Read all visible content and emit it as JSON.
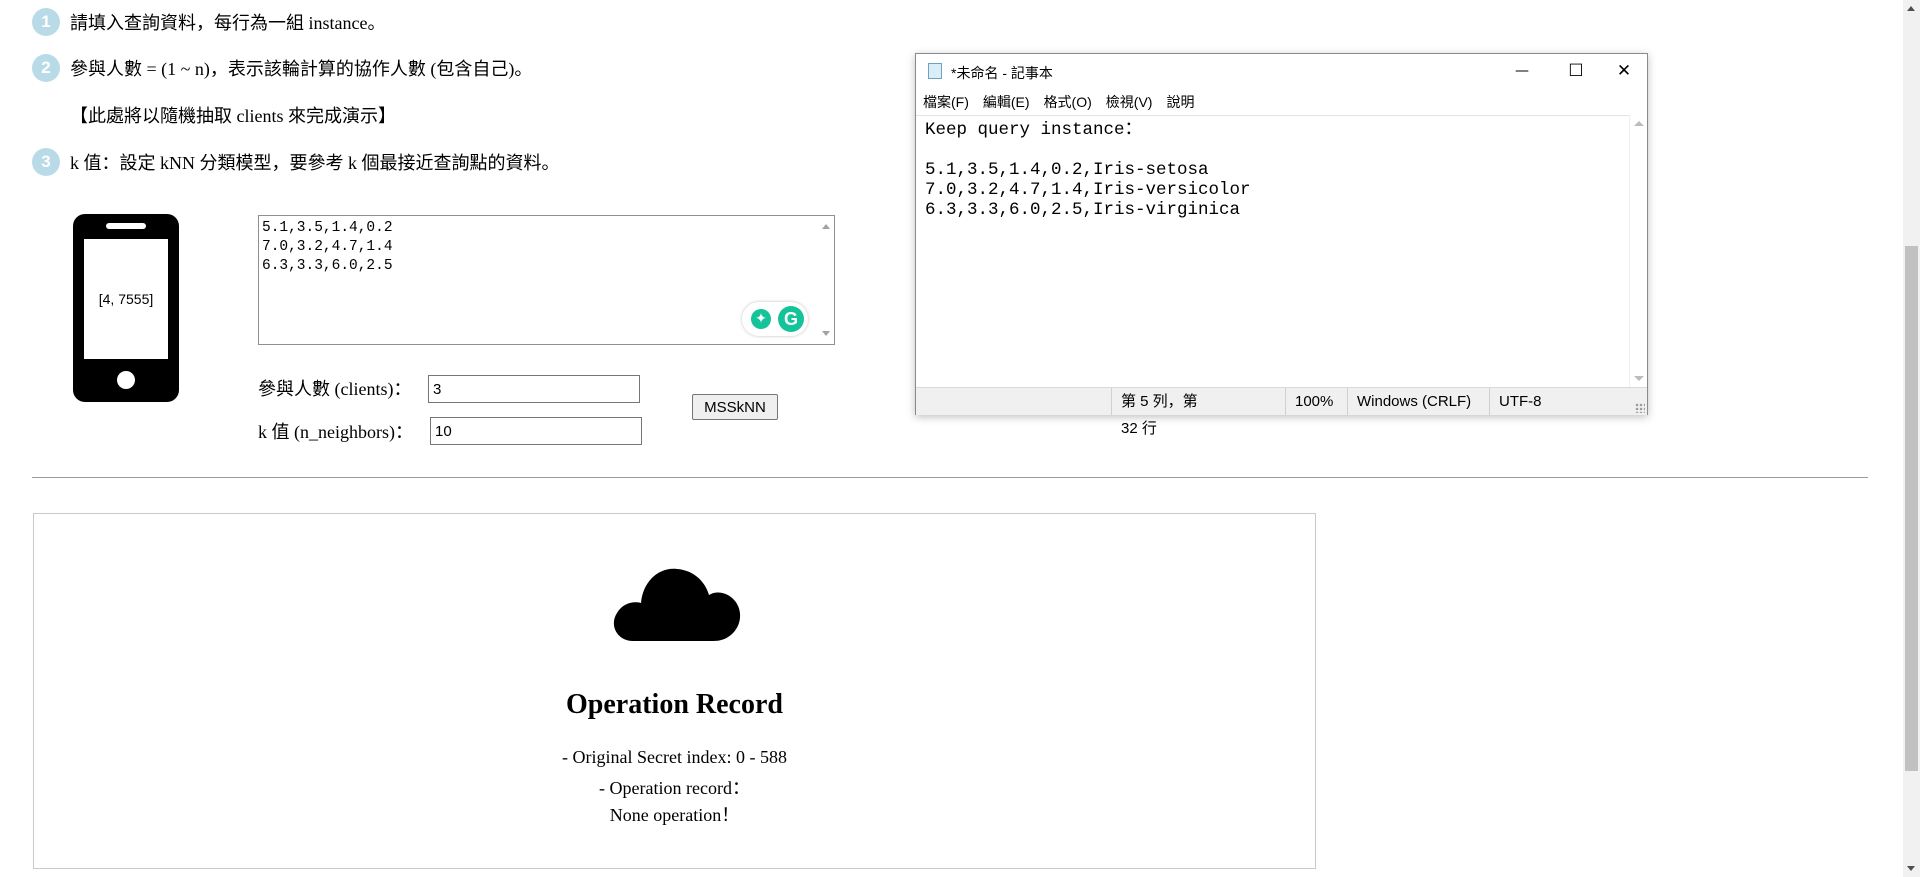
{
  "steps": [
    {
      "num": "1",
      "text": "請填入查詢資料，每行為一組 instance。"
    },
    {
      "num": "2",
      "text": "參與人數 = (1 ~ n)，表示該輪計算的協作人數 (包含自己)。"
    },
    {
      "num": "3",
      "text": "k 值：設定 kNN 分類模型，要參考 k 個最接近查詢點的資料。"
    }
  ],
  "demo_note": "【此處將以隨機抽取 clients 來完成演示】",
  "phone": {
    "screen_text": "[4, 7555]"
  },
  "query_textarea": {
    "lines": [
      "5.1,3.5,1.4,0.2",
      "7.0,3.2,4.7,1.4",
      "6.3,3.3,6.0,2.5"
    ]
  },
  "form": {
    "clients_label": "參與人數 (clients)：",
    "clients_value": "3",
    "k_label": "k 值 (n_neighbors)：",
    "k_value": "10",
    "submit_label": "MSSkNN"
  },
  "operation": {
    "icon": "cloud-icon",
    "title": "Operation Record",
    "line1": "- Original Secret index: 0 - 588",
    "line2": "- Operation record：",
    "line3": "None operation！"
  },
  "notepad": {
    "title": "*未命名 - 記事本",
    "controls": {
      "minimize": "—",
      "maximize": "☐",
      "close": "✕"
    },
    "menu": [
      "檔案(F)",
      "編輯(E)",
      "格式(O)",
      "檢視(V)",
      "說明"
    ],
    "content_lines": [
      "Keep query instance：",
      "",
      "5.1,3.5,1.4,0.2,Iris-setosa",
      "7.0,3.2,4.7,1.4,Iris-versicolor",
      "6.3,3.3,6.0,2.5,Iris-virginica"
    ],
    "status": {
      "position": "第 5 列，第 32 行",
      "zoom": "100%",
      "line_ending": "Windows (CRLF)",
      "encoding": "UTF-8"
    }
  }
}
